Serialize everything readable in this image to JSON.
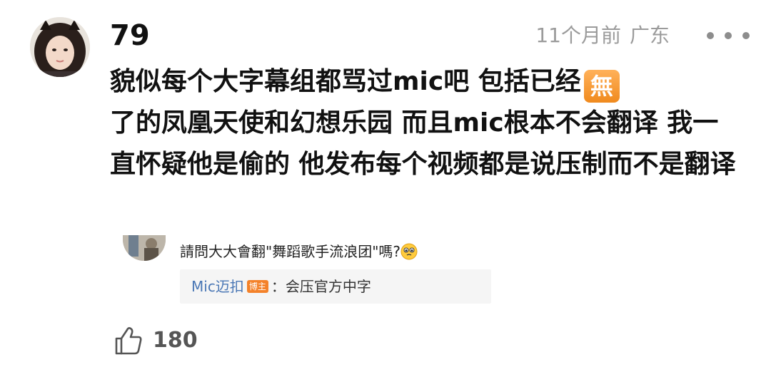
{
  "comment": {
    "username": "79",
    "time": "11个月前",
    "location": "广东",
    "text_part1": "貌似每个大字幕组都骂过mic吧 包括已经",
    "badge_char": "無",
    "text_part2": "了的凤凰天使和幻想乐园 而且mic根本不会翻译 我一直怀疑他是偷的 他发布每个视频都是说压制而不是翻译",
    "likes": "180"
  },
  "quote": {
    "question": "請問大大會翻\"舞蹈歌手流浪团\"嗎?",
    "reply_author": "Mic迈扣",
    "reply_author_badge": "博主",
    "reply_text": "：会压官方中字"
  },
  "icons": {
    "more": "more-horizontal-icon",
    "like": "thumbs-up-icon",
    "emoji": "pleading-face-emoji"
  },
  "colors": {
    "badge_orange": "#f08a1e",
    "link_blue": "#4a77b5",
    "meta_gray": "#9b9b9b"
  }
}
